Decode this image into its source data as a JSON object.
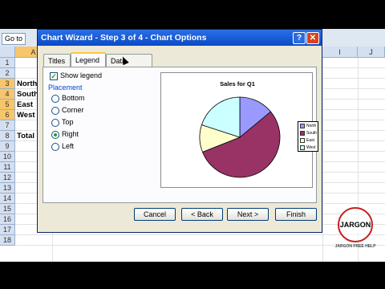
{
  "excel": {
    "goto_label": "Go to",
    "column_headers": [
      "A",
      "I",
      "J"
    ],
    "row_numbers": [
      "1",
      "2",
      "3",
      "4",
      "5",
      "6",
      "7",
      "8",
      "9",
      "10",
      "11",
      "12",
      "13",
      "14",
      "15",
      "16",
      "17",
      "18"
    ],
    "cells": [
      "North",
      "South",
      "East",
      "West",
      "Total"
    ]
  },
  "dialog": {
    "title": "Chart Wizard - Step 3 of 4 - Chart Options",
    "help_glyph": "?",
    "close_glyph": "✕",
    "tabs": [
      "Titles",
      "Legend",
      "Data Labels"
    ],
    "active_tab": "Legend",
    "show_legend_label": "Show legend",
    "show_legend_checked": true,
    "placement_label": "Placement",
    "placement_options": [
      "Bottom",
      "Corner",
      "Top",
      "Right",
      "Left"
    ],
    "placement_selected": "Right",
    "buttons": {
      "cancel": "Cancel",
      "back": "< Back",
      "next": "Next >",
      "finish": "Finish"
    }
  },
  "chart_data": {
    "type": "pie",
    "title": "Sales for Q1",
    "categories": [
      "North",
      "South",
      "East",
      "West"
    ],
    "values": [
      14,
      55,
      11,
      20
    ],
    "colors": [
      "#9999ff",
      "#993366",
      "#ffffcc",
      "#ccffff"
    ],
    "legend_position": "right"
  },
  "watermark": {
    "word": "JARGON",
    "subtitle": "JARGON FREE HELP"
  }
}
